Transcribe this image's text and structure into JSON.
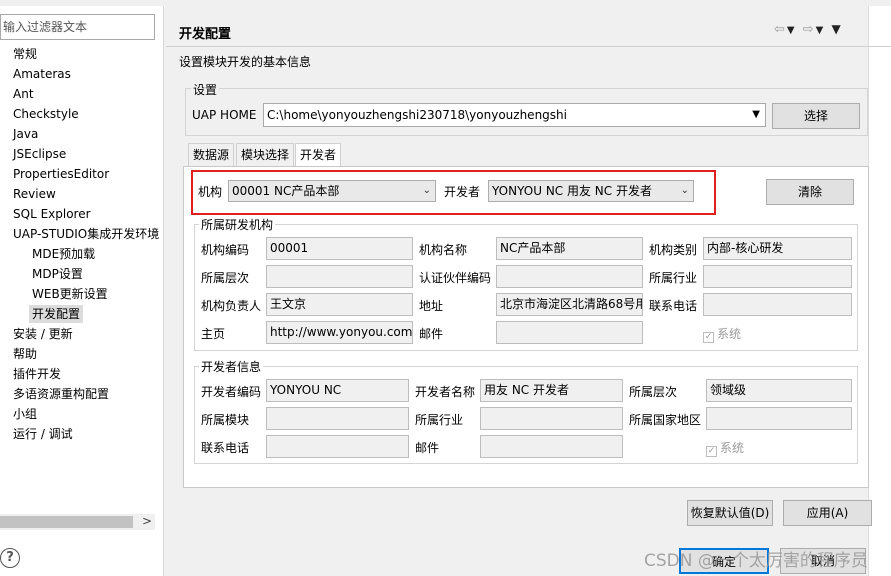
{
  "filter": {
    "placeholder": "输入过滤器文本"
  },
  "tree": {
    "items": [
      "常规",
      "Amateras",
      "Ant",
      "Checkstyle",
      "Java",
      "JSEclipse",
      "PropertiesEditor",
      "Review",
      "SQL Explorer",
      "UAP-STUDIO集成开发环境"
    ],
    "sub_items": [
      "MDE预加载",
      "MDP设置",
      "WEB更新设置",
      "开发配置"
    ],
    "items_after": [
      "安装 / 更新",
      "帮助",
      "插件开发",
      "多语资源重构配置",
      "小组",
      "运行 / 调试"
    ]
  },
  "page": {
    "title": "开发配置",
    "description": "设置模块开发的基本信息",
    "settings_group": "设置",
    "uap_home_label": "UAP HOME",
    "uap_home_value": "C:\\home\\yonyouzhengshi230718\\yonyouzhengshi",
    "select_button": "选择"
  },
  "tabs": [
    "数据源",
    "模块选择",
    "开发者"
  ],
  "developer_tab": {
    "org_label": "机构",
    "org_value": "00001 NC产品本部",
    "dev_label": "开发者",
    "dev_value": "YONYOU NC 用友 NC 开发者",
    "clear_button": "清除",
    "org_group": {
      "title": "所属研发机构",
      "org_code_label": "机构编码",
      "org_code": "00001",
      "org_name_label": "机构名称",
      "org_name": "NC产品本部",
      "org_type_label": "机构类别",
      "org_type": "内部-核心研发",
      "level_label": "所属层次",
      "level": "",
      "partner_code_label": "认证伙伴编码",
      "partner_code": "",
      "industry_label": "所属行业",
      "industry": "",
      "owner_label": "机构负责人",
      "owner": "王文京",
      "address_label": "地址",
      "address": "北京市海淀区北清路68号用",
      "phone_label": "联系电话",
      "phone": "",
      "homepage_label": "主页",
      "homepage": "http://www.yonyou.com",
      "email_label": "邮件",
      "email": "",
      "system_label": "系统"
    },
    "dev_group": {
      "title": "开发者信息",
      "dev_code_label": "开发者编码",
      "dev_code": "YONYOU NC",
      "dev_name_label": "开发者名称",
      "dev_name": "用友 NC 开发者",
      "level_label": "所属层次",
      "level": "领域级",
      "module_label": "所属模块",
      "module": "",
      "industry_label": "所属行业",
      "industry": "",
      "region_label": "所属国家地区",
      "region": "",
      "phone_label": "联系电话",
      "phone": "",
      "email_label": "邮件",
      "email": "",
      "system_label": "系统"
    }
  },
  "footer": {
    "restore_button": "恢复默认值(D)",
    "apply_button": "应用(A)",
    "ok_button": "确定",
    "cancel_button": "取消"
  },
  "watermark": "CSDN @一个太厉害的程序员",
  "colors": {
    "highlight_border": "#e02020",
    "selected_item": "#dcdcdc"
  }
}
